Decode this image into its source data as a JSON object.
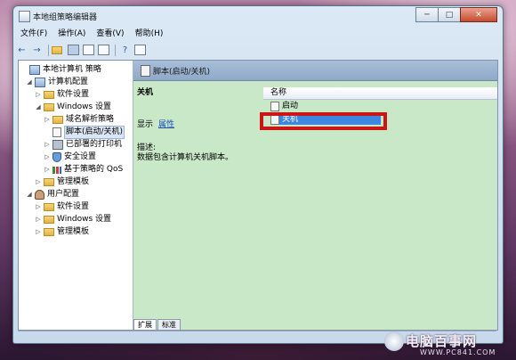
{
  "window": {
    "title": "本地组策略编辑器"
  },
  "window_buttons": {
    "minimize": "─",
    "maximize": "□",
    "close": "✕"
  },
  "menu": [
    "文件(F)",
    "操作(A)",
    "查看(V)",
    "帮助(H)"
  ],
  "toolbar": {
    "back": "←",
    "forward": "→",
    "help": "?"
  },
  "tree": [
    {
      "label": "本地计算机 策略",
      "level": 0,
      "twisty": "",
      "icon": "computer-policy-icon"
    },
    {
      "label": "计算机配置",
      "level": 1,
      "twisty": "◢",
      "icon": "computer-icon"
    },
    {
      "label": "软件设置",
      "level": 2,
      "twisty": "▷",
      "icon": "folder-icon"
    },
    {
      "label": "Windows 设置",
      "level": 2,
      "twisty": "◢",
      "icon": "folder-icon"
    },
    {
      "label": "域名解析策略",
      "level": 3,
      "twisty": "▷",
      "icon": "folder-icon"
    },
    {
      "label": "脚本(启动/关机)",
      "level": 3,
      "twisty": "",
      "icon": "script-icon"
    },
    {
      "label": "已部署的打印机",
      "level": 3,
      "twisty": "▷",
      "icon": "printer-icon"
    },
    {
      "label": "安全设置",
      "level": 3,
      "twisty": "▷",
      "icon": "shield-icon"
    },
    {
      "label": "基于策略的 QoS",
      "level": 3,
      "twisty": "▷",
      "icon": "chart-icon"
    },
    {
      "label": "管理模板",
      "level": 2,
      "twisty": "▷",
      "icon": "folder-icon"
    },
    {
      "label": "用户配置",
      "level": 1,
      "twisty": "◢",
      "icon": "user-icon"
    },
    {
      "label": "软件设置",
      "level": 2,
      "twisty": "▷",
      "icon": "folder-icon"
    },
    {
      "label": "Windows 设置",
      "level": 2,
      "twisty": "▷",
      "icon": "folder-icon"
    },
    {
      "label": "管理模板",
      "level": 2,
      "twisty": "▷",
      "icon": "folder-icon"
    }
  ],
  "right_panel": {
    "header": "脚本(启动/关机)",
    "selected_title": "关机",
    "show_label": "显示",
    "properties_link": "属性",
    "description_label": "描述:",
    "description_text": "数据包含计算机关机脚本。",
    "column_name": "名称",
    "items": [
      "启动",
      "关机"
    ]
  },
  "tabs": [
    "扩展",
    "标准"
  ],
  "watermark": {
    "brand": "电脑百事网",
    "url": "WWW.PC841.COM"
  }
}
